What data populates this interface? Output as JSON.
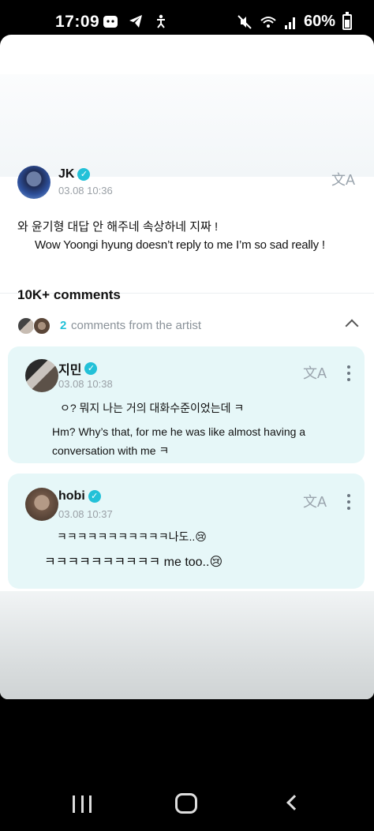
{
  "status_bar": {
    "time": "17:09",
    "battery": "60%",
    "battery_level": 0.6,
    "left_icons": [
      "app-notification-icon",
      "telegram-icon",
      "accessibility-icon"
    ],
    "right_icons": [
      "mute-icon",
      "wifi-icon",
      "signal-icon",
      "battery-icon"
    ]
  },
  "post": {
    "author": "JK",
    "timestamp": "03.08 10:36",
    "text": "와 윤기형 대답 안 해주네 속상하네 지짜 !",
    "translation": "Wow Yoongi hyung doesn’t reply to me I’m so sad really !",
    "translate_icon": "文A"
  },
  "comments_header": {
    "title": "10K+ comments",
    "artist_count": "2",
    "artist_text": "comments from the artist"
  },
  "comments": [
    {
      "author": "지민",
      "timestamp": "03.08 10:38",
      "text": "ㅇ? 뭐지 나는 거의 대화수준이었는데 ㅋ",
      "translation": "Hm? Why’s that, for me he was like almost having a conversation with me ㅋ"
    },
    {
      "author": "hobi",
      "timestamp": "03.08 10:37",
      "text": "ㅋㅋㅋㅋㅋㅋㅋㅋㅋㅋㅋ나도..😢",
      "translation": "ㅋㅋㅋㅋㅋㅋㅋㅋㅋㅋ me too..😢"
    }
  ],
  "colors": {
    "accent": "#23c1d8",
    "card_background": "#e6f7f8"
  }
}
